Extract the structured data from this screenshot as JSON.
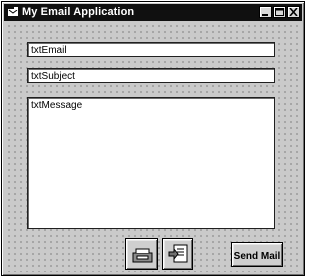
{
  "window": {
    "title": "My Email Application",
    "controls": [
      "minimize-icon",
      "maximize-icon",
      "close-icon"
    ]
  },
  "form": {
    "email_field": {
      "value": "txtEmail"
    },
    "subject_field": {
      "value": "txtSubject"
    },
    "message_field": {
      "value": "txtMessage"
    }
  },
  "buttons": {
    "attach_icon": "mail-tray-icon",
    "address_icon": "address-book-icon",
    "send_label": "Send Mail"
  }
}
